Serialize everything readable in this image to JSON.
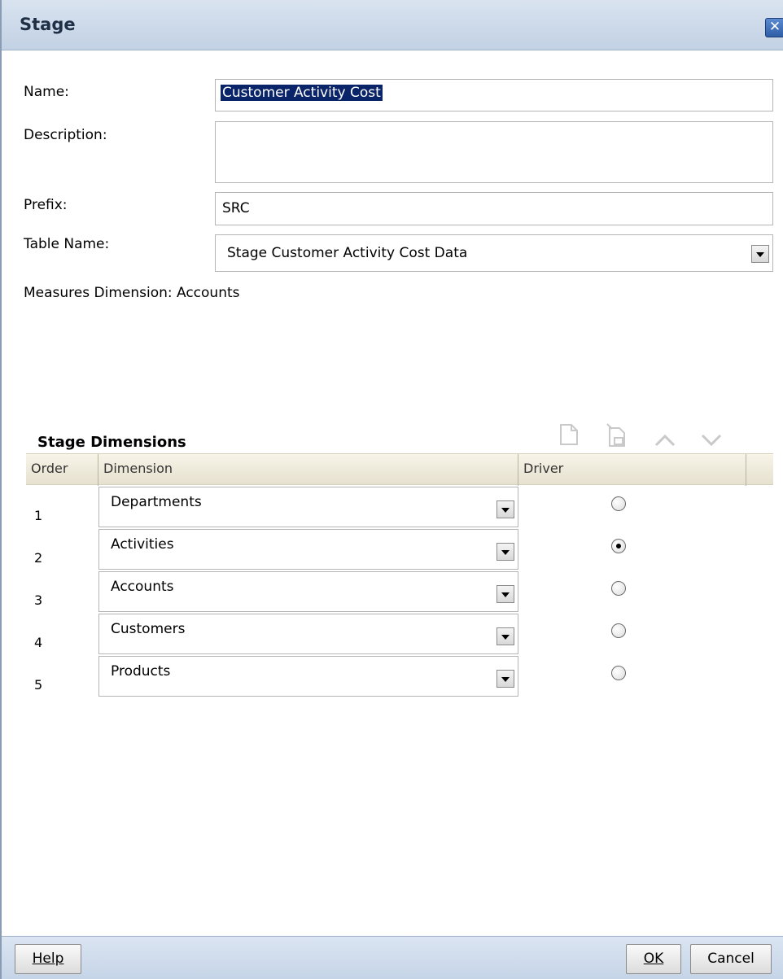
{
  "dialog": {
    "title": "Stage"
  },
  "form": {
    "name_label": "Name:",
    "name_value": "Customer Activity Cost",
    "description_label": "Description:",
    "description_value": "",
    "prefix_label": "Prefix:",
    "prefix_value": "SRC",
    "table_name_label": "Table Name:",
    "table_name_value": "Stage Customer Activity Cost Data",
    "measures_dimension": "Measures Dimension: Accounts"
  },
  "stage_dimensions": {
    "title": "Stage Dimensions",
    "columns": [
      "Order",
      "Dimension",
      "Driver"
    ],
    "rows": [
      {
        "order": "1",
        "dimension": "Departments",
        "driver": false
      },
      {
        "order": "2",
        "dimension": "Activities",
        "driver": true
      },
      {
        "order": "3",
        "dimension": "Accounts",
        "driver": false
      },
      {
        "order": "4",
        "dimension": "Customers",
        "driver": false
      },
      {
        "order": "5",
        "dimension": "Products",
        "driver": false
      }
    ],
    "toolbar_icons": [
      "new-document-icon",
      "delete-document-icon",
      "move-up-icon",
      "move-down-icon"
    ]
  },
  "footer": {
    "help_label": "Help",
    "ok_label": "OK",
    "cancel_label": "Cancel"
  },
  "colors": {
    "title_bar": "#c9d7e8",
    "selection": "#0a246a",
    "grid_header": "#ece8d8"
  }
}
